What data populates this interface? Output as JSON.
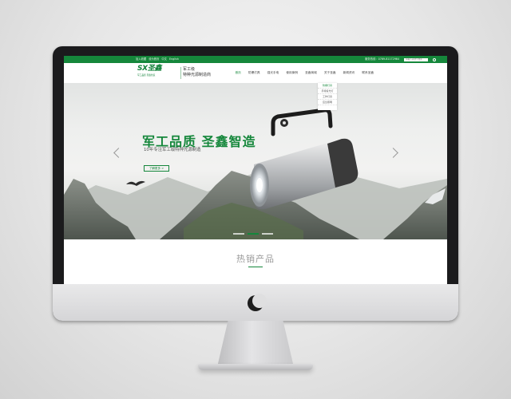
{
  "topbar": {
    "links": [
      "加入收藏",
      "设为首页",
      "中文",
      "English"
    ],
    "hotline": "服务热线：0769-81172964",
    "search_placeholder": "请输入关键字搜索"
  },
  "logo": {
    "mark": "SX圣鑫",
    "slogan": "军工品质  圣鑫智造",
    "line1": "军工级",
    "line2": "特种光源制造商"
  },
  "nav": {
    "items": [
      "首页",
      "防爆灯具",
      "强光手电",
      "使用案例",
      "圣鑫商城",
      "关于圣鑫",
      "新闻资讯",
      "联系圣鑫"
    ],
    "active_index": 0
  },
  "dropdown": {
    "items": [
      "防爆灯具",
      "手持投光灯",
      "工作灯具",
      "应急照明"
    ]
  },
  "hero": {
    "title": "军工品质  圣鑫智造",
    "subtitle": "10年专注军工级特种光源制造",
    "button": "了解更多 >",
    "slides_total": 3,
    "slide_active": 1
  },
  "section": {
    "title": "热销产品"
  },
  "colors": {
    "brand_green": "#15873b"
  }
}
